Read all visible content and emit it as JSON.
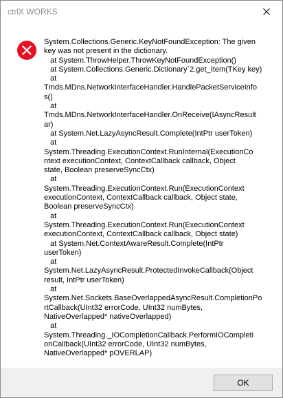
{
  "window": {
    "title": "ctrlX WORKS"
  },
  "icons": {
    "close": "close-icon",
    "error": "error-icon",
    "error_color": "#e81123"
  },
  "message": {
    "lines": [
      "System.Collections.Generic.KeyNotFoundException: The given",
      "key was not present in the dictionary.",
      "   at System.ThrowHelper.ThrowKeyNotFoundException()",
      "   at System.Collections.Generic.Dictionary`2.get_Item(TKey key)",
      "   at",
      "Tmds.MDns.NetworkInterfaceHandler.HandlePacketServiceInfo",
      "s()",
      "   at",
      "Tmds.MDns.NetworkInterfaceHandler.OnReceive(IAsyncResult",
      "ar)",
      "   at System.Net.LazyAsyncResult.Complete(IntPtr userToken)",
      "   at",
      "System.Threading.ExecutionContext.RunInternal(ExecutionCo",
      "ntext executionContext, ContextCallback callback, Object",
      "state, Boolean preserveSyncCtx)",
      "   at",
      "System.Threading.ExecutionContext.Run(ExecutionContext",
      "executionContext, ContextCallback callback, Object state,",
      "Boolean preserveSyncCtx)",
      "   at",
      "System.Threading.ExecutionContext.Run(ExecutionContext",
      "executionContext, ContextCallback callback, Object state)",
      "   at System.Net.ContextAwareResult.Complete(IntPtr",
      "userToken)",
      "   at",
      "System.Net.LazyAsyncResult.ProtectedInvokeCallback(Object",
      "result, IntPtr userToken)",
      "   at",
      "System.Net.Sockets.BaseOverlappedAsyncResult.CompletionPo",
      "rtCallback(UInt32 errorCode, UInt32 numBytes,",
      "NativeOverlapped* nativeOverlapped)",
      "   at",
      "System.Threading._IOCompletionCallback.PerformIOCompleti",
      "onCallback(UInt32 errorCode, UInt32 numBytes,",
      "NativeOverlapped* pOVERLAP)"
    ]
  },
  "buttons": {
    "ok_label": "OK"
  }
}
